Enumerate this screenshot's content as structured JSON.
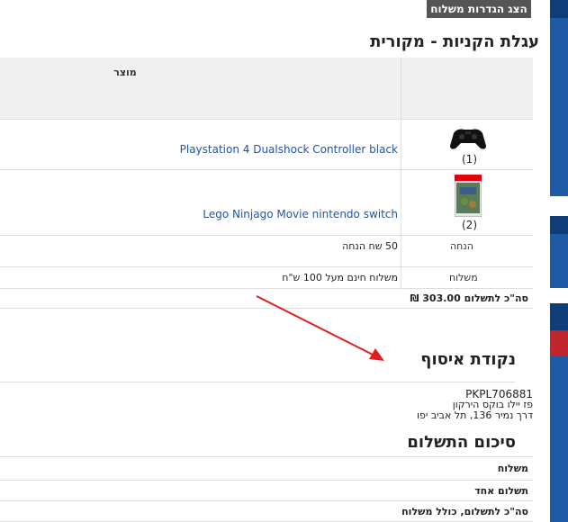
{
  "shipping_settings_button": "הצג הגדרות משלוח",
  "cart_title": "עגלת הקניות - מקורית",
  "table_header_product": "מוצר",
  "items": [
    {
      "name": "Playstation 4 Dualshock Controller black",
      "qty": "(1)",
      "thumb": "gamepad-thumbnail"
    },
    {
      "name": "Lego Ninjago Movie nintendo switch",
      "qty": "(2)",
      "thumb": "game-box-thumbnail"
    }
  ],
  "discount": {
    "label": "הנחה",
    "value": "50 שח הנחה"
  },
  "shipping": {
    "label": "משלוח",
    "value": "משלוח חינם מעל 100 ש\"ח"
  },
  "total": "סה\"כ לתשלום 303.00 ₪",
  "pickup_title": "נקודת איסוף",
  "pickup": {
    "code": "PKPL706881",
    "name": "פז יילו בוקס הירקון",
    "address": "דרך נמיר 136, תל אביב יפו"
  },
  "payment_summary_title": "סיכום התשלום",
  "payment_summary_rows": [
    "משלוח",
    "תשלום אחד",
    "סה\"כ לתשלום, כולל משלוח"
  ],
  "colors": {
    "link": "#1a56b0",
    "arrow": "#e02020",
    "side_tab": "#1f5aa6",
    "side_tab_red": "#c0242d"
  }
}
